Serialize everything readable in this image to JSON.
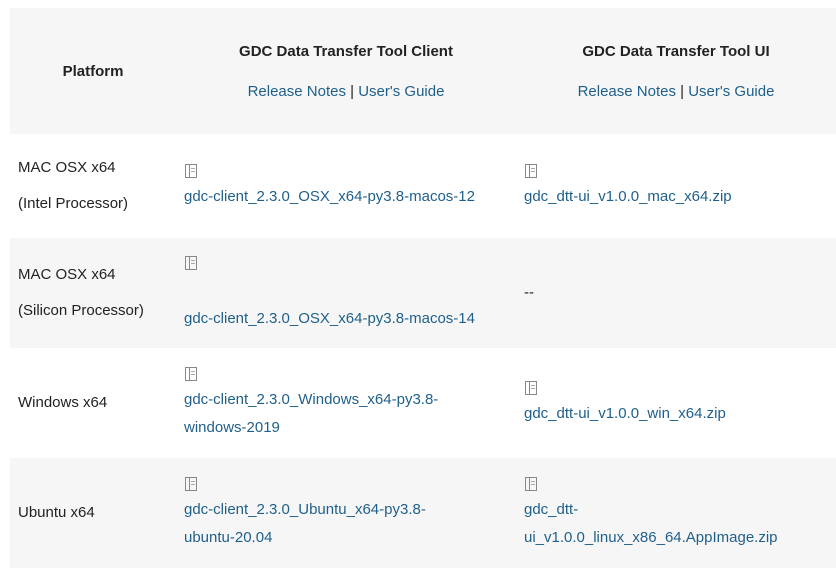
{
  "header": {
    "platform": "Platform",
    "client": {
      "title": "GDC Data Transfer Tool Client",
      "release_notes": "Release Notes",
      "separator": "|",
      "users_guide": "User's Guide"
    },
    "ui": {
      "title": "GDC Data Transfer Tool UI",
      "release_notes": "Release Notes",
      "separator": "|",
      "users_guide": "User's Guide"
    }
  },
  "rows": [
    {
      "platform_line1": "MAC OSX x64",
      "platform_line2": "(Intel Processor)",
      "client_file": "gdc-client_2.3.0_OSX_x64-py3.8-macos-12",
      "ui_file": "gdc_dtt-ui_v1.0.0_mac_x64.zip"
    },
    {
      "platform_line1": "MAC OSX x64",
      "platform_line2": "(Silicon Processor)",
      "client_file": "gdc-client_2.3.0_OSX_x64-py3.8-macos-14",
      "ui_file": "--"
    },
    {
      "platform_line1": "Windows x64",
      "client_file_line1": "gdc-client_2.3.0_Windows_x64-py3.8-",
      "client_file_line2": "windows-2019",
      "ui_file": "gdc_dtt-ui_v1.0.0_win_x64.zip"
    },
    {
      "platform_line1": "Ubuntu x64",
      "client_file_line1": "gdc-client_2.3.0_Ubuntu_x64-py3.8-",
      "client_file_line2": "ubuntu-20.04",
      "ui_file_line1": "gdc_dtt-",
      "ui_file_line2": "ui_v1.0.0_linux_x86_64.AppImage.zip"
    }
  ],
  "icons": {
    "file": "file-icon"
  },
  "colors": {
    "link": "#1f5f8b",
    "stripe": "#f6f6f6",
    "text": "#222222"
  }
}
